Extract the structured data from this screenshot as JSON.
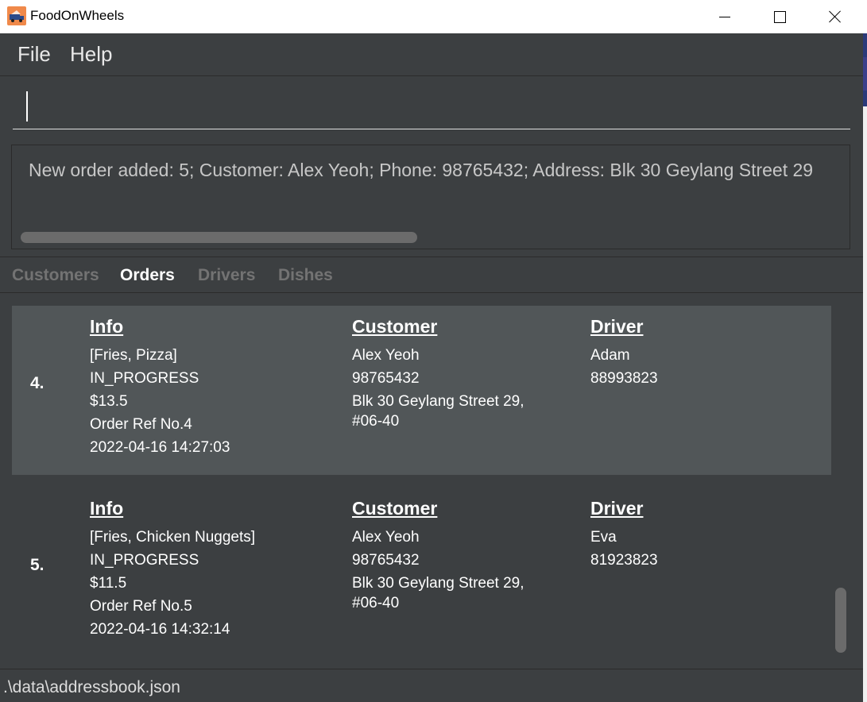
{
  "window": {
    "title": "FoodOnWheels",
    "icon": "food-truck-icon"
  },
  "menu": {
    "file": "File",
    "help": "Help"
  },
  "command": {
    "value": ""
  },
  "result": {
    "text": "New order added: 5; Customer: Alex Yeoh; Phone: 98765432; Address: Blk 30 Geylang Street 29"
  },
  "tabs": [
    {
      "label": "Customers",
      "active": false
    },
    {
      "label": "Orders",
      "active": true
    },
    {
      "label": "Drivers",
      "active": false
    },
    {
      "label": "Dishes",
      "active": false
    }
  ],
  "orders": [
    {
      "index": "4.",
      "info_header": "Info",
      "dishes": "[Fries, Pizza]",
      "status": "IN_PROGRESS",
      "price": "$13.5",
      "ref": "Order Ref No.4",
      "datetime": "2022-04-16 14:27:03",
      "customer_header": "Customer",
      "customer_name": "Alex Yeoh",
      "customer_phone": "98765432",
      "customer_address": "Blk 30 Geylang Street 29, #06-40",
      "driver_header": "Driver",
      "driver_name": "Adam",
      "driver_phone": "88993823"
    },
    {
      "index": "5.",
      "info_header": "Info",
      "dishes": "[Fries, Chicken Nuggets]",
      "status": "IN_PROGRESS",
      "price": "$11.5",
      "ref": "Order Ref No.5",
      "datetime": "2022-04-16 14:32:14",
      "customer_header": "Customer",
      "customer_name": "Alex Yeoh",
      "customer_phone": "98765432",
      "customer_address": "Blk 30 Geylang Street 29, #06-40",
      "driver_header": "Driver",
      "driver_name": "Eva",
      "driver_phone": "81923823"
    }
  ],
  "status": {
    "path": ".\\data\\addressbook.json"
  },
  "colors": {
    "background": "#3c3f41",
    "selected_card": "#515658",
    "inactive_tab": "#737373"
  }
}
